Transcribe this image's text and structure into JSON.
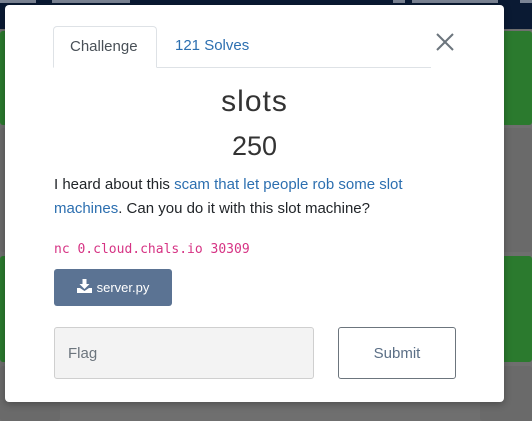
{
  "modal": {
    "tabs": [
      {
        "label": "Challenge"
      },
      {
        "label": "121 Solves"
      }
    ],
    "title": "slots",
    "value": "250",
    "description": {
      "prefix": "I heard about this ",
      "link_text": "scam that let people rob some slot machines",
      "suffix": ". Can you do it with this slot machine?"
    },
    "command": "nc 0.cloud.chals.io 30309",
    "file_button": {
      "label": "server.py",
      "icon": "download-icon"
    },
    "flag_input": {
      "placeholder": "Flag",
      "value": ""
    },
    "submit_label": "Submit",
    "close_icon": "close-icon"
  },
  "colors": {
    "link": "#2c6fb0",
    "file_button_bg": "#5b7393",
    "command_text": "#d63384",
    "backdrop_green": "#2b7a2e",
    "navbar": "#0a1a33"
  }
}
